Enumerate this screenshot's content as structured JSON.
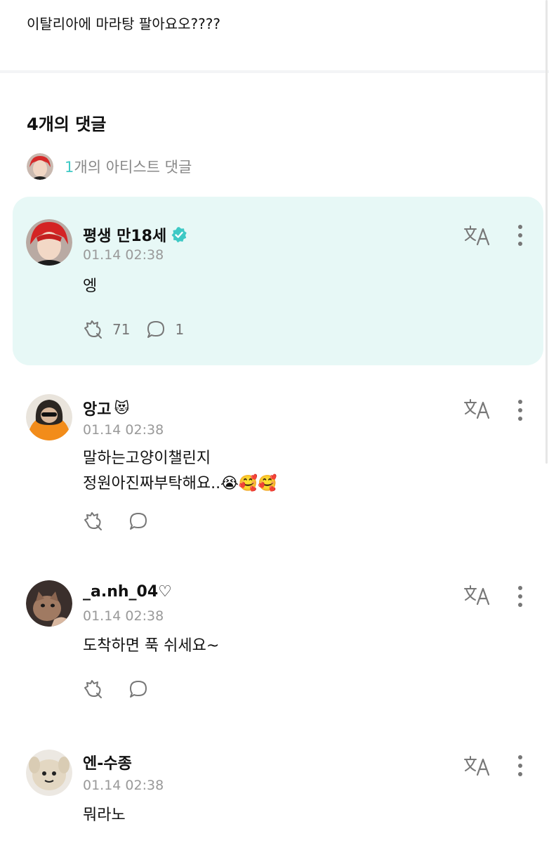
{
  "post": {
    "text": "이탈리아에 마라탕 팔아요오????"
  },
  "comments_section": {
    "title": "4개의 댓글",
    "artist_summary": {
      "count": "1",
      "label": "개의 아티스트 댓글"
    }
  },
  "comments": [
    {
      "username": "평생 만18세",
      "verified": true,
      "time": "01.14 02:38",
      "lines": [
        "엥"
      ],
      "likes": "71",
      "replies": "1",
      "avatar": "red-haired-artist-avatar"
    },
    {
      "username": "앙고",
      "badge": "😻",
      "time": "01.14 02:38",
      "lines": [
        "말하는고양이챌린지",
        "정원아진짜부탁해요..😭🥰🥰"
      ],
      "avatar": "orange-hoodie-avatar"
    },
    {
      "username": "_a.nh_04♡",
      "time": "01.14 02:38",
      "lines": [
        "도착하면 푹 쉬세요~"
      ],
      "avatar": "cat-photo-avatar"
    },
    {
      "username": "엔-수종",
      "time": "01.14 02:38",
      "lines": [
        "뭐라노"
      ],
      "avatar": "plush-toy-avatar"
    }
  ],
  "colors": {
    "accent": "#3ec9c5",
    "highlight_bg": "#e7f8f6",
    "muted": "#999999"
  }
}
